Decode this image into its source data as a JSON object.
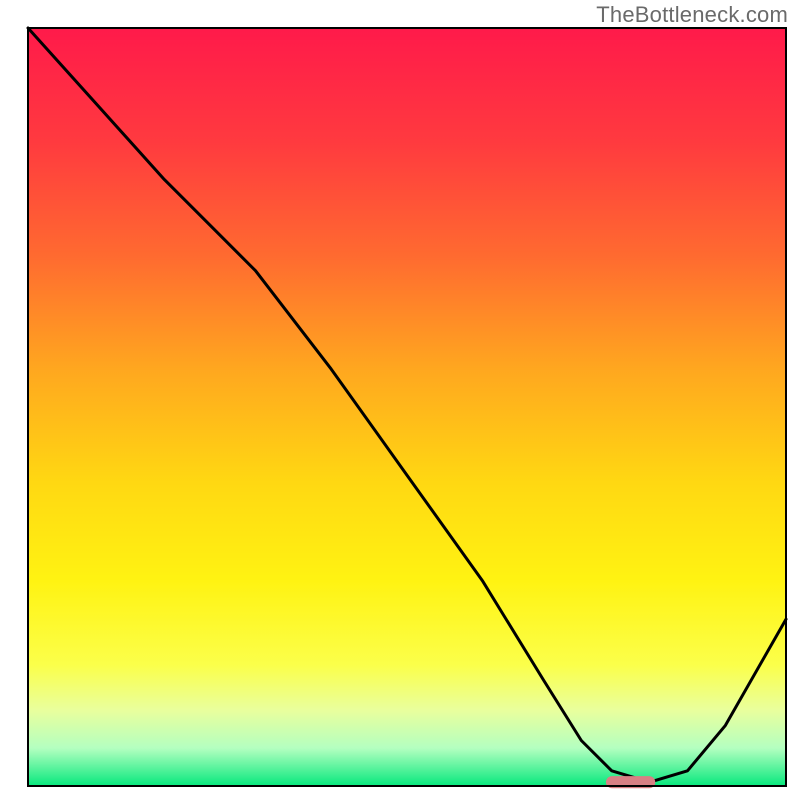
{
  "watermark": "TheBottleneck.com",
  "chart_data": {
    "type": "line",
    "title": "",
    "xlabel": "",
    "ylabel": "",
    "xlim": [
      0,
      100
    ],
    "ylim": [
      0,
      100
    ],
    "background": {
      "type": "vertical-gradient",
      "stops": [
        {
          "pos": 0.0,
          "color": "#ff1a4a"
        },
        {
          "pos": 0.15,
          "color": "#ff3a3f"
        },
        {
          "pos": 0.3,
          "color": "#ff6a30"
        },
        {
          "pos": 0.45,
          "color": "#ffa71f"
        },
        {
          "pos": 0.6,
          "color": "#ffd812"
        },
        {
          "pos": 0.73,
          "color": "#fff312"
        },
        {
          "pos": 0.84,
          "color": "#fbff4a"
        },
        {
          "pos": 0.9,
          "color": "#e9ff9d"
        },
        {
          "pos": 0.95,
          "color": "#b4ffc0"
        },
        {
          "pos": 1.0,
          "color": "#07e87d"
        }
      ]
    },
    "series": [
      {
        "name": "curve",
        "color": "#000000",
        "x": [
          0.0,
          9.0,
          18.0,
          24.0,
          30.0,
          40.0,
          50.0,
          60.0,
          68.0,
          73.0,
          77.0,
          82.0,
          87.0,
          92.0,
          100.0
        ],
        "y": [
          100.0,
          90.0,
          80.0,
          74.0,
          68.0,
          55.0,
          41.0,
          27.0,
          14.0,
          6.0,
          2.0,
          0.5,
          2.0,
          8.0,
          22.0
        ]
      }
    ],
    "marker": {
      "name": "highlight",
      "shape": "rounded-rect",
      "color": "#d88084",
      "x": 79.5,
      "y": 0.5,
      "w": 6.5,
      "h": 1.6
    },
    "frame": {
      "color": "#000000",
      "width": 2
    }
  }
}
